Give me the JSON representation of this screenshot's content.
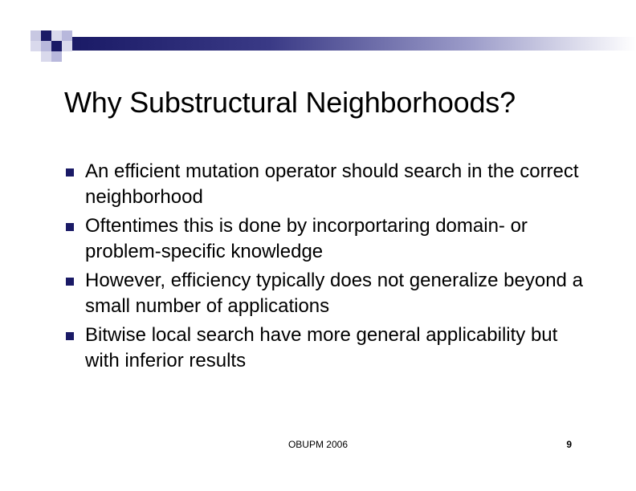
{
  "slide": {
    "title": "Why Substructural Neighborhoods?",
    "bullets": [
      "An efficient mutation operator should search in the correct neighborhood",
      "Oftentimes this is done by incorportaring domain- or problem-specific knowledge",
      "However, efficiency typically does not generalize beyond a small number of applications",
      "Bitwise local search have more general applicability but with inferior results"
    ],
    "bullet_icon": "square-bullet-icon"
  },
  "footer": {
    "center_text": "OBUPM 2006",
    "page_number": "9"
  },
  "colors": {
    "accent_dark": "#1a1a66",
    "accent_light": "#b8b8dc",
    "accent_faint": "#d9d9ec",
    "text": "#000000",
    "background": "#ffffff"
  }
}
